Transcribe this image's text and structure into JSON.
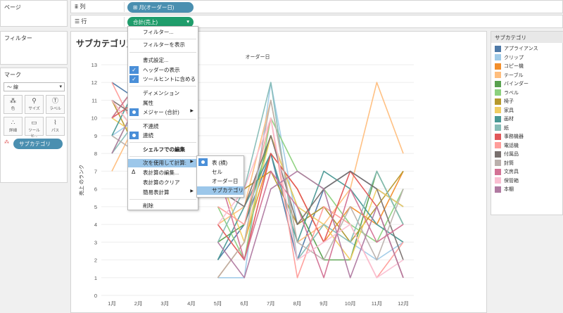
{
  "pages_title": "ページ",
  "filters_title": "フィルター",
  "marks": {
    "title": "マーク",
    "mark_type_icon": "line-icon",
    "mark_type": "線",
    "buttons": [
      {
        "label": "色",
        "icon": "color-icon"
      },
      {
        "label": "サイズ",
        "icon": "size-icon"
      },
      {
        "label": "ラベル",
        "icon": "label-icon"
      },
      {
        "label": "詳細",
        "icon": "detail-icon"
      },
      {
        "label": "ツールヒ...",
        "icon": "tooltip-icon"
      },
      {
        "label": "パス",
        "icon": "path-icon"
      }
    ],
    "color_pill": "サブカテゴリ"
  },
  "shelves": {
    "columns_label": "列",
    "columns_pill": "⊞ 月(オーダー日)",
    "rows_label": "行",
    "rows_pill": "合計(売上)"
  },
  "view": {
    "title": "サブカテゴリ別売",
    "header": "オーダー日"
  },
  "context_menu": {
    "items": [
      "フィルター...",
      "フィルターを表示",
      "書式設定...",
      "ヘッダーの表示",
      "ツールヒントに含める",
      "ディメンション",
      "属性",
      "メジャー (合計)",
      "不連続",
      "連続",
      "シェルフでの編集",
      "次を使用して計算:",
      "表計算の編集...",
      "表計算のクリア",
      "簡易表計算",
      "削除"
    ]
  },
  "submenu": {
    "items": [
      "表 (横)",
      "セル",
      "オーダー日",
      "サブカテゴリ"
    ]
  },
  "legend": {
    "title": "サブカテゴリ",
    "items": [
      {
        "name": "アプライアンス",
        "color": "#4e79a7"
      },
      {
        "name": "クリップ",
        "color": "#a0cbe8"
      },
      {
        "name": "コピー機",
        "color": "#f28e2b"
      },
      {
        "name": "テーブル",
        "color": "#ffbe7d"
      },
      {
        "name": "バインダー",
        "color": "#59a14f"
      },
      {
        "name": "ラベル",
        "color": "#8cd17d"
      },
      {
        "name": "椅子",
        "color": "#b6992d"
      },
      {
        "name": "家具",
        "color": "#f1ce63"
      },
      {
        "name": "画材",
        "color": "#499894"
      },
      {
        "name": "紙",
        "color": "#86bcb6"
      },
      {
        "name": "事務機器",
        "color": "#e15759"
      },
      {
        "name": "電話機",
        "color": "#ff9d9a"
      },
      {
        "name": "付属品",
        "color": "#79706e"
      },
      {
        "name": "封筒",
        "color": "#bab0ac"
      },
      {
        "name": "文房具",
        "color": "#d37295"
      },
      {
        "name": "保管箱",
        "color": "#fabfd2"
      },
      {
        "name": "本棚",
        "color": "#b07aa1"
      }
    ]
  },
  "chart_data": {
    "type": "line",
    "title": "サブカテゴリ別売",
    "xlabel": "オーダー日",
    "ylabel": "売上 のランク",
    "categories": [
      "1月",
      "2月",
      "3月",
      "4月",
      "5月",
      "6月",
      "7月",
      "8月",
      "9月",
      "10月",
      "11月",
      "12月"
    ],
    "ylim": [
      0,
      13
    ],
    "yticks": [
      0,
      1,
      2,
      3,
      4,
      5,
      6,
      7,
      8,
      9,
      10,
      11,
      12,
      13
    ],
    "series": [
      {
        "name": "アプライアンス",
        "values": [
          12,
          11,
          null,
          null,
          2,
          4,
          8,
          2,
          6,
          7,
          6,
          5
        ]
      },
      {
        "name": "クリップ",
        "values": [
          9,
          10,
          null,
          null,
          1,
          1,
          12,
          4,
          5,
          3,
          2,
          3
        ]
      },
      {
        "name": "コピー機",
        "values": [
          11,
          9,
          null,
          null,
          1,
          3,
          8,
          6,
          3,
          5,
          4,
          7
        ]
      },
      {
        "name": "テーブル",
        "values": [
          7,
          10,
          null,
          null,
          4,
          5,
          11,
          3,
          4,
          6,
          12,
          8
        ]
      },
      {
        "name": "バインダー",
        "values": [
          10,
          12,
          null,
          null,
          3,
          4,
          9,
          5,
          2,
          2,
          7,
          4
        ]
      },
      {
        "name": "ラベル",
        "values": [
          8,
          11,
          null,
          null,
          5,
          2,
          10,
          7,
          6,
          4,
          3,
          6
        ]
      },
      {
        "name": "椅子",
        "values": [
          11,
          8,
          null,
          null,
          6,
          6,
          7,
          4,
          5,
          3,
          5,
          7
        ]
      },
      {
        "name": "家具",
        "values": [
          10,
          9,
          null,
          null,
          7,
          3,
          9,
          5,
          4,
          2,
          6,
          5
        ]
      },
      {
        "name": "画材",
        "values": [
          9,
          12,
          null,
          null,
          2,
          5,
          8,
          3,
          7,
          6,
          4,
          3
        ]
      },
      {
        "name": "紙",
        "values": [
          8,
          10,
          null,
          null,
          3,
          6,
          12,
          2,
          4,
          3,
          7,
          4
        ]
      },
      {
        "name": "事務機器",
        "values": [
          10,
          11,
          null,
          null,
          4,
          2,
          8,
          6,
          3,
          7,
          5,
          1
        ]
      },
      {
        "name": "電話機",
        "values": [
          12,
          9,
          null,
          null,
          5,
          4,
          10,
          1,
          5,
          4,
          1,
          3
        ]
      },
      {
        "name": "付属品",
        "values": [
          11,
          10,
          null,
          null,
          6,
          5,
          9,
          4,
          6,
          7,
          6,
          2
        ]
      },
      {
        "name": "封筒",
        "values": [
          9,
          8,
          null,
          null,
          1,
          3,
          11,
          3,
          2,
          5,
          2,
          6
        ]
      },
      {
        "name": "文房具",
        "values": [
          10,
          12,
          null,
          null,
          7,
          2,
          7,
          5,
          1,
          6,
          3,
          4
        ]
      },
      {
        "name": "保管箱",
        "values": [
          11,
          9,
          null,
          null,
          4,
          6,
          10,
          2,
          3,
          4,
          1,
          2
        ]
      },
      {
        "name": "本棚",
        "values": [
          8,
          11,
          null,
          null,
          3,
          1,
          6,
          7,
          6,
          1,
          5,
          1
        ]
      }
    ]
  }
}
